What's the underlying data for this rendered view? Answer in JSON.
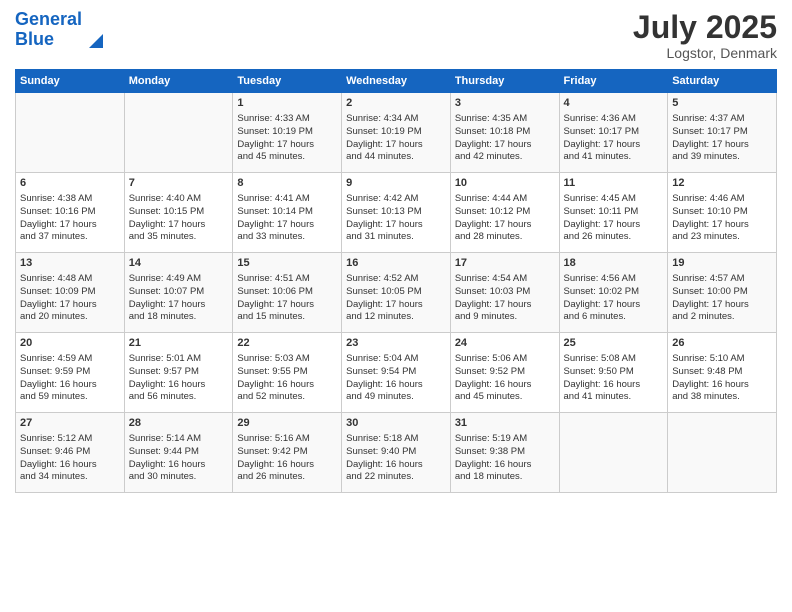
{
  "logo": {
    "line1": "General",
    "line2": "Blue"
  },
  "title": "July 2025",
  "subtitle": "Logstor, Denmark",
  "days_of_week": [
    "Sunday",
    "Monday",
    "Tuesday",
    "Wednesday",
    "Thursday",
    "Friday",
    "Saturday"
  ],
  "weeks": [
    [
      {
        "day": "",
        "content": ""
      },
      {
        "day": "",
        "content": ""
      },
      {
        "day": "1",
        "content": "Sunrise: 4:33 AM\nSunset: 10:19 PM\nDaylight: 17 hours\nand 45 minutes."
      },
      {
        "day": "2",
        "content": "Sunrise: 4:34 AM\nSunset: 10:19 PM\nDaylight: 17 hours\nand 44 minutes."
      },
      {
        "day": "3",
        "content": "Sunrise: 4:35 AM\nSunset: 10:18 PM\nDaylight: 17 hours\nand 42 minutes."
      },
      {
        "day": "4",
        "content": "Sunrise: 4:36 AM\nSunset: 10:17 PM\nDaylight: 17 hours\nand 41 minutes."
      },
      {
        "day": "5",
        "content": "Sunrise: 4:37 AM\nSunset: 10:17 PM\nDaylight: 17 hours\nand 39 minutes."
      }
    ],
    [
      {
        "day": "6",
        "content": "Sunrise: 4:38 AM\nSunset: 10:16 PM\nDaylight: 17 hours\nand 37 minutes."
      },
      {
        "day": "7",
        "content": "Sunrise: 4:40 AM\nSunset: 10:15 PM\nDaylight: 17 hours\nand 35 minutes."
      },
      {
        "day": "8",
        "content": "Sunrise: 4:41 AM\nSunset: 10:14 PM\nDaylight: 17 hours\nand 33 minutes."
      },
      {
        "day": "9",
        "content": "Sunrise: 4:42 AM\nSunset: 10:13 PM\nDaylight: 17 hours\nand 31 minutes."
      },
      {
        "day": "10",
        "content": "Sunrise: 4:44 AM\nSunset: 10:12 PM\nDaylight: 17 hours\nand 28 minutes."
      },
      {
        "day": "11",
        "content": "Sunrise: 4:45 AM\nSunset: 10:11 PM\nDaylight: 17 hours\nand 26 minutes."
      },
      {
        "day": "12",
        "content": "Sunrise: 4:46 AM\nSunset: 10:10 PM\nDaylight: 17 hours\nand 23 minutes."
      }
    ],
    [
      {
        "day": "13",
        "content": "Sunrise: 4:48 AM\nSunset: 10:09 PM\nDaylight: 17 hours\nand 20 minutes."
      },
      {
        "day": "14",
        "content": "Sunrise: 4:49 AM\nSunset: 10:07 PM\nDaylight: 17 hours\nand 18 minutes."
      },
      {
        "day": "15",
        "content": "Sunrise: 4:51 AM\nSunset: 10:06 PM\nDaylight: 17 hours\nand 15 minutes."
      },
      {
        "day": "16",
        "content": "Sunrise: 4:52 AM\nSunset: 10:05 PM\nDaylight: 17 hours\nand 12 minutes."
      },
      {
        "day": "17",
        "content": "Sunrise: 4:54 AM\nSunset: 10:03 PM\nDaylight: 17 hours\nand 9 minutes."
      },
      {
        "day": "18",
        "content": "Sunrise: 4:56 AM\nSunset: 10:02 PM\nDaylight: 17 hours\nand 6 minutes."
      },
      {
        "day": "19",
        "content": "Sunrise: 4:57 AM\nSunset: 10:00 PM\nDaylight: 17 hours\nand 2 minutes."
      }
    ],
    [
      {
        "day": "20",
        "content": "Sunrise: 4:59 AM\nSunset: 9:59 PM\nDaylight: 16 hours\nand 59 minutes."
      },
      {
        "day": "21",
        "content": "Sunrise: 5:01 AM\nSunset: 9:57 PM\nDaylight: 16 hours\nand 56 minutes."
      },
      {
        "day": "22",
        "content": "Sunrise: 5:03 AM\nSunset: 9:55 PM\nDaylight: 16 hours\nand 52 minutes."
      },
      {
        "day": "23",
        "content": "Sunrise: 5:04 AM\nSunset: 9:54 PM\nDaylight: 16 hours\nand 49 minutes."
      },
      {
        "day": "24",
        "content": "Sunrise: 5:06 AM\nSunset: 9:52 PM\nDaylight: 16 hours\nand 45 minutes."
      },
      {
        "day": "25",
        "content": "Sunrise: 5:08 AM\nSunset: 9:50 PM\nDaylight: 16 hours\nand 41 minutes."
      },
      {
        "day": "26",
        "content": "Sunrise: 5:10 AM\nSunset: 9:48 PM\nDaylight: 16 hours\nand 38 minutes."
      }
    ],
    [
      {
        "day": "27",
        "content": "Sunrise: 5:12 AM\nSunset: 9:46 PM\nDaylight: 16 hours\nand 34 minutes."
      },
      {
        "day": "28",
        "content": "Sunrise: 5:14 AM\nSunset: 9:44 PM\nDaylight: 16 hours\nand 30 minutes."
      },
      {
        "day": "29",
        "content": "Sunrise: 5:16 AM\nSunset: 9:42 PM\nDaylight: 16 hours\nand 26 minutes."
      },
      {
        "day": "30",
        "content": "Sunrise: 5:18 AM\nSunset: 9:40 PM\nDaylight: 16 hours\nand 22 minutes."
      },
      {
        "day": "31",
        "content": "Sunrise: 5:19 AM\nSunset: 9:38 PM\nDaylight: 16 hours\nand 18 minutes."
      },
      {
        "day": "",
        "content": ""
      },
      {
        "day": "",
        "content": ""
      }
    ]
  ]
}
